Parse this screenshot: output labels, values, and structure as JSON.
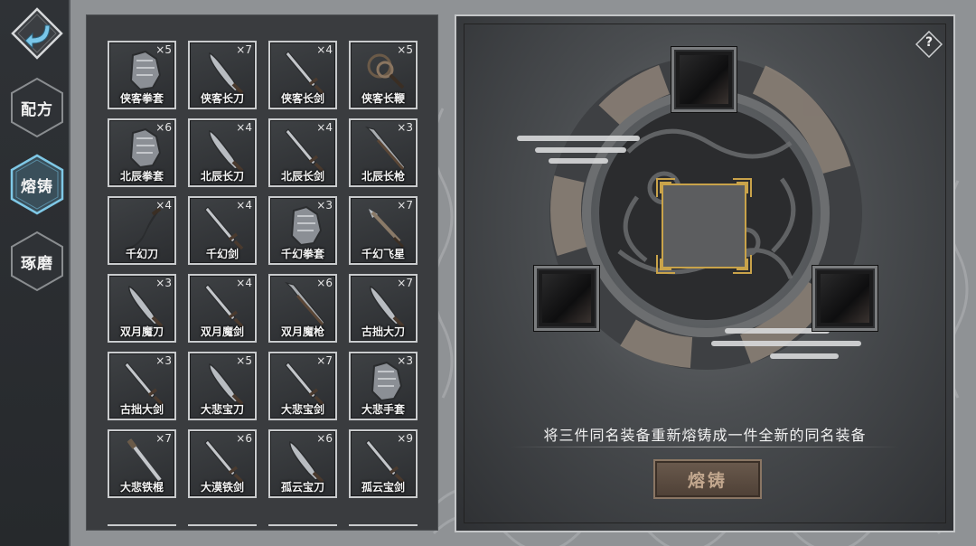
{
  "nav": {
    "back_icon": "back-arrow-icon",
    "tabs": [
      {
        "label": "配方",
        "active": false
      },
      {
        "label": "熔铸",
        "active": true
      },
      {
        "label": "琢磨",
        "active": false
      }
    ]
  },
  "inventory": {
    "items": [
      {
        "name": "侠客拳套",
        "count": "×5",
        "icon": "gauntlet-icon"
      },
      {
        "name": "侠客长刀",
        "count": "×7",
        "icon": "saber-icon"
      },
      {
        "name": "侠客长剑",
        "count": "×4",
        "icon": "sword-icon"
      },
      {
        "name": "侠客长鞭",
        "count": "×5",
        "icon": "whip-icon"
      },
      {
        "name": "北辰拳套",
        "count": "×6",
        "icon": "gauntlet-icon"
      },
      {
        "name": "北辰长刀",
        "count": "×4",
        "icon": "saber-icon"
      },
      {
        "name": "北辰长剑",
        "count": "×4",
        "icon": "sword-icon"
      },
      {
        "name": "北辰长枪",
        "count": "×3",
        "icon": "spear-icon"
      },
      {
        "name": "千幻刀",
        "count": "×4",
        "icon": "curved-blade-icon"
      },
      {
        "name": "千幻剑",
        "count": "×4",
        "icon": "sword-icon"
      },
      {
        "name": "千幻拳套",
        "count": "×3",
        "icon": "gauntlet-icon"
      },
      {
        "name": "千幻飞星",
        "count": "×7",
        "icon": "dart-icon"
      },
      {
        "name": "双月魔刀",
        "count": "×3",
        "icon": "saber-icon"
      },
      {
        "name": "双月魔剑",
        "count": "×4",
        "icon": "sword-icon"
      },
      {
        "name": "双月魔枪",
        "count": "×6",
        "icon": "spear-icon"
      },
      {
        "name": "古拙大刀",
        "count": "×7",
        "icon": "saber-icon"
      },
      {
        "name": "古拙大剑",
        "count": "×3",
        "icon": "sword-icon"
      },
      {
        "name": "大悲宝刀",
        "count": "×5",
        "icon": "saber-icon"
      },
      {
        "name": "大悲宝剑",
        "count": "×7",
        "icon": "sword-icon"
      },
      {
        "name": "大悲手套",
        "count": "×3",
        "icon": "gauntlet-icon"
      },
      {
        "name": "大悲铁棍",
        "count": "×7",
        "icon": "staff-icon"
      },
      {
        "name": "大漠铁剑",
        "count": "×6",
        "icon": "sword-icon"
      },
      {
        "name": "孤云宝刀",
        "count": "×6",
        "icon": "saber-icon"
      },
      {
        "name": "孤云宝剑",
        "count": "×9",
        "icon": "sword-icon"
      }
    ]
  },
  "forge": {
    "help_label": "?",
    "description": "将三件同名装备重新熔铸成一件全新的同名装备",
    "button_label": "熔铸",
    "slots": [
      "top",
      "left",
      "right",
      "center"
    ]
  },
  "colors": {
    "panel": "#3a3c3f",
    "frame": "#c9cbcd",
    "button_text": "#c2a78e",
    "gold_frame": "#c9a34a"
  }
}
